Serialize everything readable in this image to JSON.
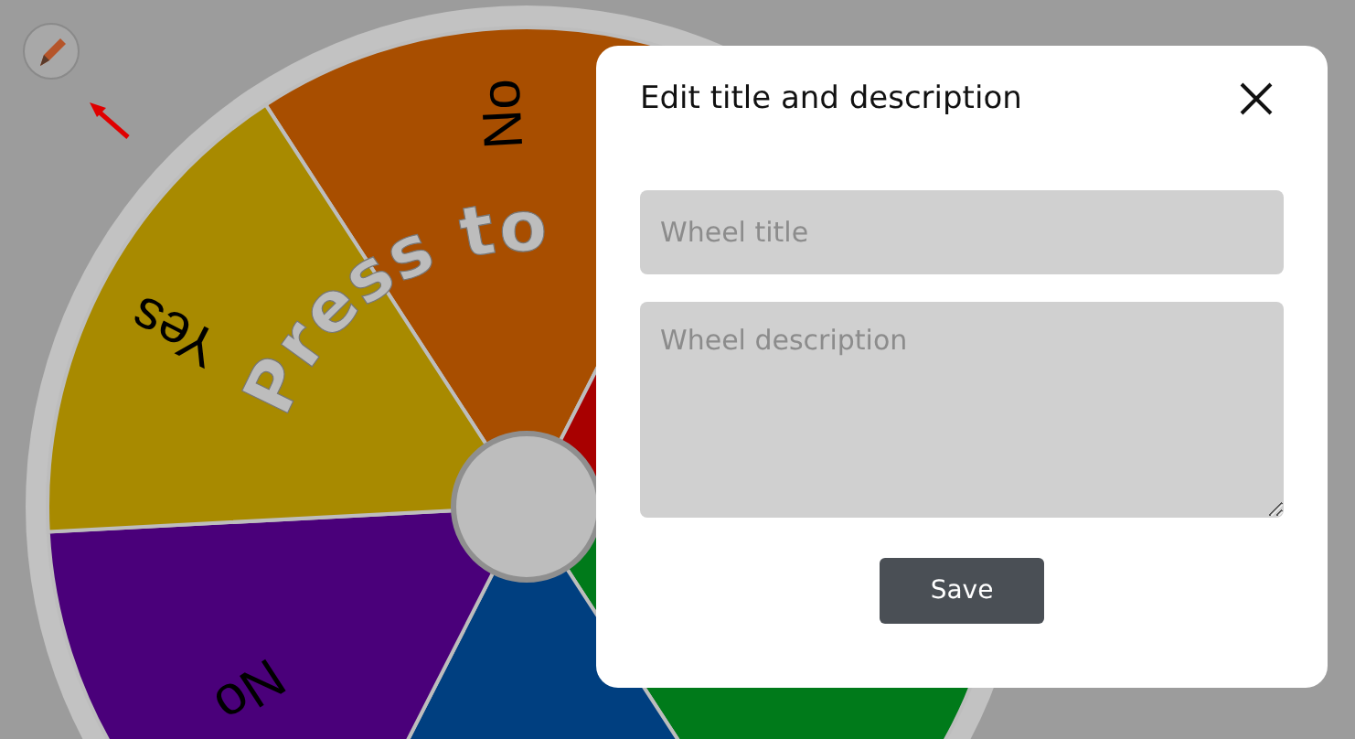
{
  "wheel": {
    "center_text": "Press to",
    "segments": [
      {
        "label": "No",
        "color": "#a84e00"
      },
      {
        "color": "#a80000"
      },
      {
        "color": "#007a1a"
      },
      {
        "color": "#003f80"
      },
      {
        "label": "No",
        "color": "#4a007a"
      },
      {
        "label": "Yes",
        "color": "#a88a00"
      }
    ]
  },
  "modal": {
    "title": "Edit title and description",
    "title_field": {
      "placeholder": "Wheel title"
    },
    "description_field": {
      "placeholder": "Wheel description"
    },
    "save_button": "Save"
  }
}
